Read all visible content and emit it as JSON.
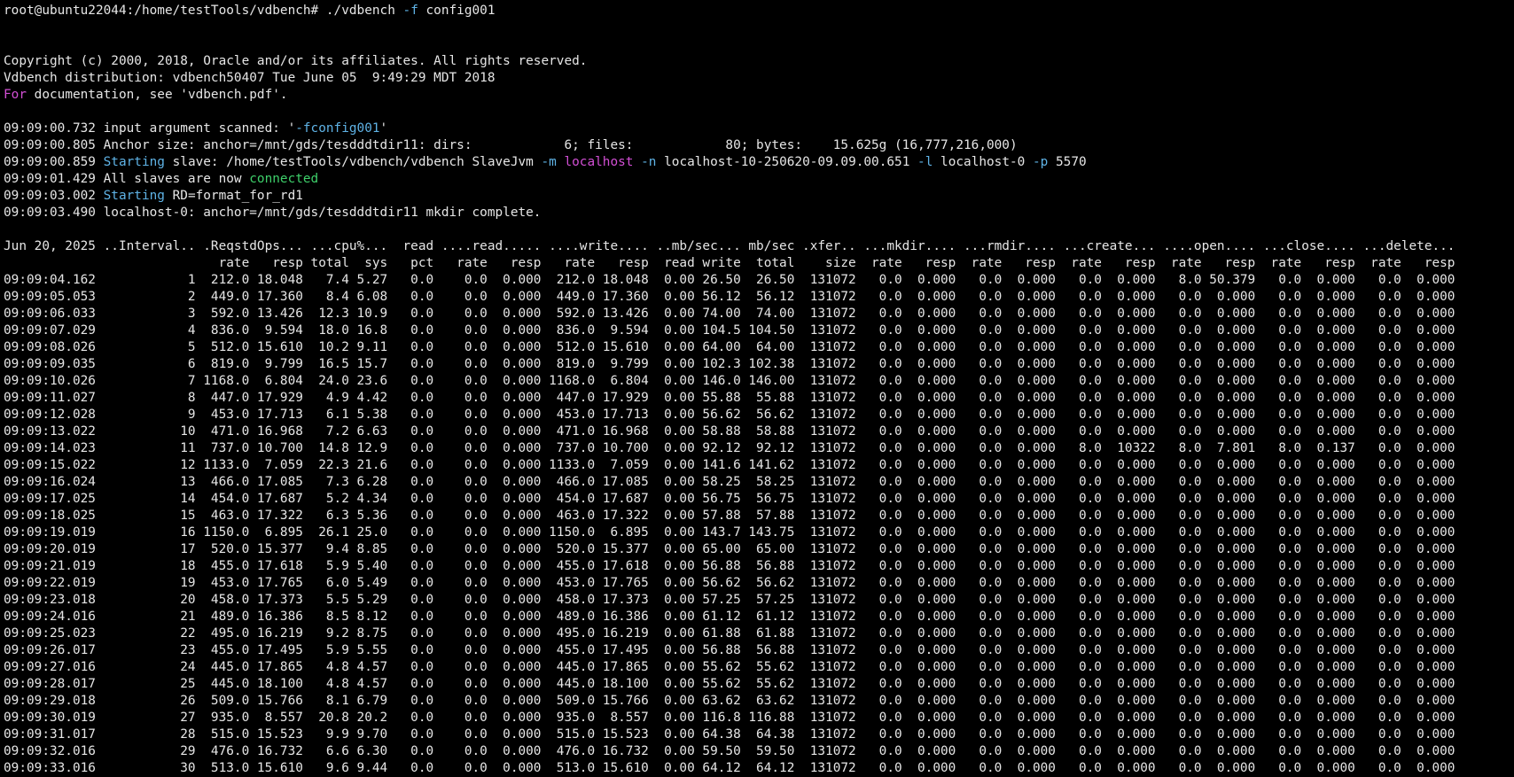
{
  "colors": {
    "background": "#000000",
    "foreground": "#e6e6e6",
    "flag": "#5fb3e6",
    "keyword": "#d24fd4",
    "string": "#5fb3e6",
    "success": "#3ecf6a"
  },
  "prompt": {
    "user_host_path": "root@ubuntu22044:/home/testTools/vdbench# ",
    "command": "./vdbench ",
    "flag": "-f",
    "arg": " config001"
  },
  "header": {
    "copyright": "Copyright (c) 2000, 2018, Oracle and/or its affiliates. All rights reserved.",
    "distribution": "Vdbench distribution: vdbench50407 Tue June 05  9:49:29 MDT 2018",
    "doc_for": "For",
    "doc_rest": " documentation, see 'vdbench.pdf'."
  },
  "log": {
    "l1_ts": "09:09:00.732 input argument scanned: '",
    "l1_arg": "-fconfig001",
    "l1_end": "'",
    "l2": "09:09:00.805 Anchor size: anchor=/mnt/gds/tesdddtdir11: dirs:            6; files:            80; bytes:    15.625g (16,777,216,000)",
    "l3_ts": "09:09:00.859 ",
    "l3_starting": "Starting",
    "l3_a": " slave: /home/testTools/vdbench/vdbench SlaveJvm ",
    "l3_m": "-m",
    "l3_sp": " ",
    "l3_localhost": "localhost",
    "l3_sp2": " ",
    "l3_n": "-n",
    "l3_b": " localhost-10-250620-09.09.00.651 ",
    "l3_l": "-l",
    "l3_c": " localhost-0 ",
    "l3_p": "-p",
    "l3_d": " 5570",
    "l4_ts": "09:09:01.429 All slaves are now ",
    "l4_connected": "connected",
    "l5_ts": "09:09:03.002 ",
    "l5_starting": "Starting",
    "l5_rest": " RD=format_for_rd1",
    "l6": "09:09:03.490 localhost-0: anchor=/mnt/gds/tesdddtdir11 mkdir complete."
  },
  "table": {
    "header1": "Jun 20, 2025 ..Interval.. .ReqstdOps... ...cpu%...  read ....read..... ....write.... ..mb/sec... mb/sec .xfer.. ...mkdir.... ...rmdir.... ...create... ....open.... ...close.... ...delete...",
    "header2": "                            rate   resp total  sys   pct   rate   resp   rate   resp  read write  total    size  rate   resp  rate   resp  rate   resp  rate   resp  rate   resp  rate   resp",
    "rows": [
      "09:09:04.162            1  212.0 18.048   7.4 5.27   0.0    0.0  0.000  212.0 18.048  0.00 26.50  26.50  131072   0.0  0.000   0.0  0.000   0.0  0.000   8.0 50.379   0.0  0.000   0.0  0.000",
      "09:09:05.053            2  449.0 17.360   8.4 6.08   0.0    0.0  0.000  449.0 17.360  0.00 56.12  56.12  131072   0.0  0.000   0.0  0.000   0.0  0.000   0.0  0.000   0.0  0.000   0.0  0.000",
      "09:09:06.033            3  592.0 13.426  12.3 10.9   0.0    0.0  0.000  592.0 13.426  0.00 74.00  74.00  131072   0.0  0.000   0.0  0.000   0.0  0.000   0.0  0.000   0.0  0.000   0.0  0.000",
      "09:09:07.029            4  836.0  9.594  18.0 16.8   0.0    0.0  0.000  836.0  9.594  0.00 104.5 104.50  131072   0.0  0.000   0.0  0.000   0.0  0.000   0.0  0.000   0.0  0.000   0.0  0.000",
      "09:09:08.026            5  512.0 15.610  10.2 9.11   0.0    0.0  0.000  512.0 15.610  0.00 64.00  64.00  131072   0.0  0.000   0.0  0.000   0.0  0.000   0.0  0.000   0.0  0.000   0.0  0.000",
      "09:09:09.035            6  819.0  9.799  16.5 15.7   0.0    0.0  0.000  819.0  9.799  0.00 102.3 102.38  131072   0.0  0.000   0.0  0.000   0.0  0.000   0.0  0.000   0.0  0.000   0.0  0.000",
      "09:09:10.026            7 1168.0  6.804  24.0 23.6   0.0    0.0  0.000 1168.0  6.804  0.00 146.0 146.00  131072   0.0  0.000   0.0  0.000   0.0  0.000   0.0  0.000   0.0  0.000   0.0  0.000",
      "09:09:11.027            8  447.0 17.929   4.9 4.42   0.0    0.0  0.000  447.0 17.929  0.00 55.88  55.88  131072   0.0  0.000   0.0  0.000   0.0  0.000   0.0  0.000   0.0  0.000   0.0  0.000",
      "09:09:12.028            9  453.0 17.713   6.1 5.38   0.0    0.0  0.000  453.0 17.713  0.00 56.62  56.62  131072   0.0  0.000   0.0  0.000   0.0  0.000   0.0  0.000   0.0  0.000   0.0  0.000",
      "09:09:13.022           10  471.0 16.968   7.2 6.63   0.0    0.0  0.000  471.0 16.968  0.00 58.88  58.88  131072   0.0  0.000   0.0  0.000   0.0  0.000   0.0  0.000   0.0  0.000   0.0  0.000",
      "09:09:14.023           11  737.0 10.700  14.8 12.9   0.0    0.0  0.000  737.0 10.700  0.00 92.12  92.12  131072   0.0  0.000   0.0  0.000   8.0  10322   8.0  7.801   8.0  0.137   0.0  0.000",
      "09:09:15.022           12 1133.0  7.059  22.3 21.6   0.0    0.0  0.000 1133.0  7.059  0.00 141.6 141.62  131072   0.0  0.000   0.0  0.000   0.0  0.000   0.0  0.000   0.0  0.000   0.0  0.000",
      "09:09:16.024           13  466.0 17.085   7.3 6.28   0.0    0.0  0.000  466.0 17.085  0.00 58.25  58.25  131072   0.0  0.000   0.0  0.000   0.0  0.000   0.0  0.000   0.0  0.000   0.0  0.000",
      "09:09:17.025           14  454.0 17.687   5.2 4.34   0.0    0.0  0.000  454.0 17.687  0.00 56.75  56.75  131072   0.0  0.000   0.0  0.000   0.0  0.000   0.0  0.000   0.0  0.000   0.0  0.000",
      "09:09:18.025           15  463.0 17.322   6.3 5.36   0.0    0.0  0.000  463.0 17.322  0.00 57.88  57.88  131072   0.0  0.000   0.0  0.000   0.0  0.000   0.0  0.000   0.0  0.000   0.0  0.000",
      "09:09:19.019           16 1150.0  6.895  26.1 25.0   0.0    0.0  0.000 1150.0  6.895  0.00 143.7 143.75  131072   0.0  0.000   0.0  0.000   0.0  0.000   0.0  0.000   0.0  0.000   0.0  0.000",
      "09:09:20.019           17  520.0 15.377   9.4 8.85   0.0    0.0  0.000  520.0 15.377  0.00 65.00  65.00  131072   0.0  0.000   0.0  0.000   0.0  0.000   0.0  0.000   0.0  0.000   0.0  0.000",
      "09:09:21.019           18  455.0 17.618   5.9 5.40   0.0    0.0  0.000  455.0 17.618  0.00 56.88  56.88  131072   0.0  0.000   0.0  0.000   0.0  0.000   0.0  0.000   0.0  0.000   0.0  0.000",
      "09:09:22.019           19  453.0 17.765   6.0 5.49   0.0    0.0  0.000  453.0 17.765  0.00 56.62  56.62  131072   0.0  0.000   0.0  0.000   0.0  0.000   0.0  0.000   0.0  0.000   0.0  0.000",
      "09:09:23.018           20  458.0 17.373   5.5 5.29   0.0    0.0  0.000  458.0 17.373  0.00 57.25  57.25  131072   0.0  0.000   0.0  0.000   0.0  0.000   0.0  0.000   0.0  0.000   0.0  0.000",
      "09:09:24.016           21  489.0 16.386   8.5 8.12   0.0    0.0  0.000  489.0 16.386  0.00 61.12  61.12  131072   0.0  0.000   0.0  0.000   0.0  0.000   0.0  0.000   0.0  0.000   0.0  0.000",
      "09:09:25.023           22  495.0 16.219   9.2 8.75   0.0    0.0  0.000  495.0 16.219  0.00 61.88  61.88  131072   0.0  0.000   0.0  0.000   0.0  0.000   0.0  0.000   0.0  0.000   0.0  0.000",
      "09:09:26.017           23  455.0 17.495   5.9 5.55   0.0    0.0  0.000  455.0 17.495  0.00 56.88  56.88  131072   0.0  0.000   0.0  0.000   0.0  0.000   0.0  0.000   0.0  0.000   0.0  0.000",
      "09:09:27.016           24  445.0 17.865   4.8 4.57   0.0    0.0  0.000  445.0 17.865  0.00 55.62  55.62  131072   0.0  0.000   0.0  0.000   0.0  0.000   0.0  0.000   0.0  0.000   0.0  0.000",
      "09:09:28.017           25  445.0 18.100   4.8 4.57   0.0    0.0  0.000  445.0 18.100  0.00 55.62  55.62  131072   0.0  0.000   0.0  0.000   0.0  0.000   0.0  0.000   0.0  0.000   0.0  0.000",
      "09:09:29.018           26  509.0 15.766   8.1 6.79   0.0    0.0  0.000  509.0 15.766  0.00 63.62  63.62  131072   0.0  0.000   0.0  0.000   0.0  0.000   0.0  0.000   0.0  0.000   0.0  0.000",
      "09:09:30.019           27  935.0  8.557  20.8 20.2   0.0    0.0  0.000  935.0  8.557  0.00 116.8 116.88  131072   0.0  0.000   0.0  0.000   0.0  0.000   0.0  0.000   0.0  0.000   0.0  0.000",
      "09:09:31.017           28  515.0 15.523   9.9 9.70   0.0    0.0  0.000  515.0 15.523  0.00 64.38  64.38  131072   0.0  0.000   0.0  0.000   0.0  0.000   0.0  0.000   0.0  0.000   0.0  0.000",
      "09:09:32.016           29  476.0 16.732   6.6 6.30   0.0    0.0  0.000  476.0 16.732  0.00 59.50  59.50  131072   0.0  0.000   0.0  0.000   0.0  0.000   0.0  0.000   0.0  0.000   0.0  0.000",
      "09:09:33.016           30  513.0 15.610   9.6 9.44   0.0    0.0  0.000  513.0 15.610  0.00 64.12  64.12  131072   0.0  0.000   0.0  0.000   0.0  0.000   0.0  0.000   0.0  0.000   0.0  0.000"
    ]
  }
}
